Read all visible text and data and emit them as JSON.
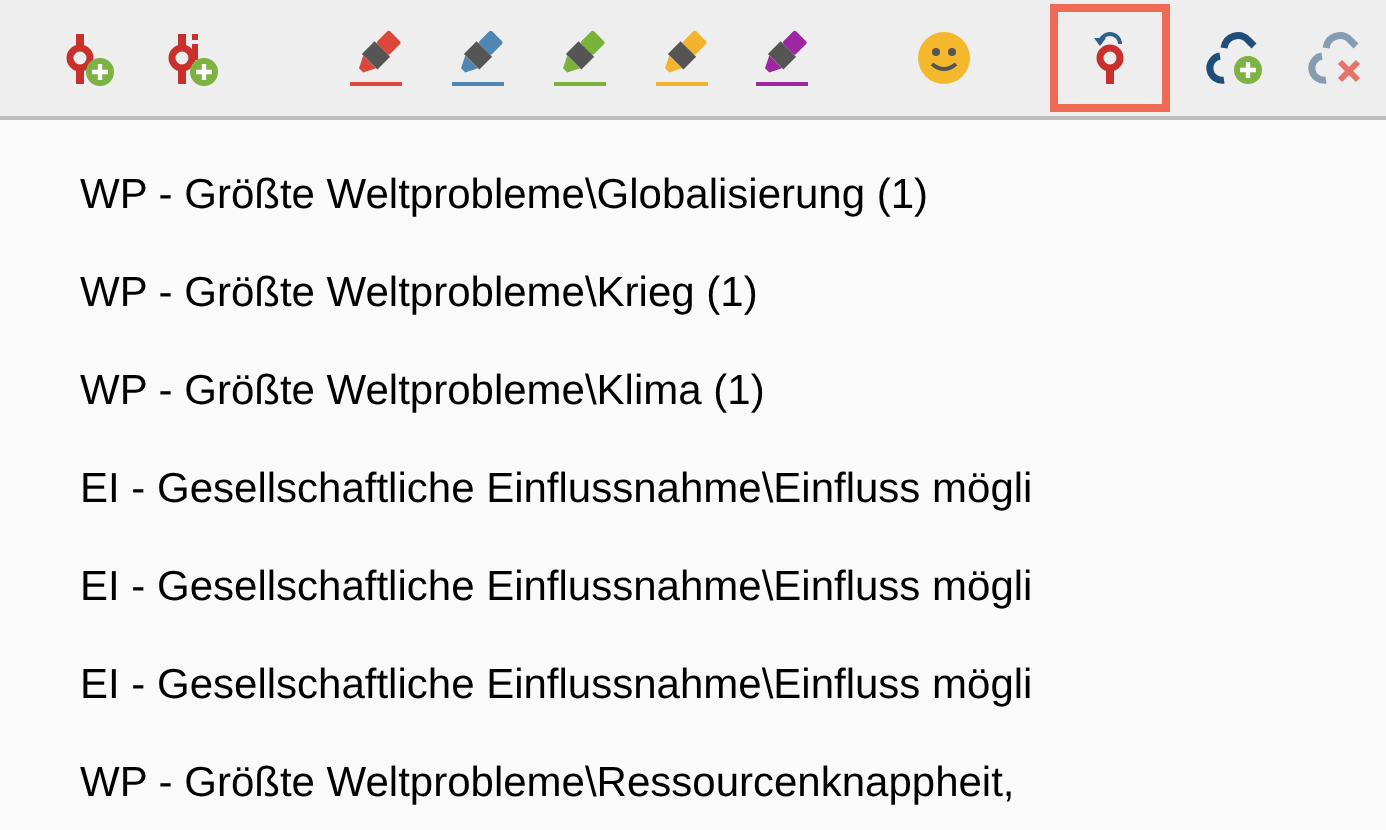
{
  "toolbar": [
    {
      "kind": "code-add",
      "selected": false
    },
    {
      "kind": "code-invivo",
      "selected": false
    },
    {
      "kind": "highlighter",
      "color": "#d9483b",
      "selected": false
    },
    {
      "kind": "highlighter",
      "color": "#4f86b4",
      "selected": false
    },
    {
      "kind": "highlighter",
      "color": "#7bb33a",
      "selected": false
    },
    {
      "kind": "highlighter",
      "color": "#f2b32f",
      "selected": false
    },
    {
      "kind": "highlighter",
      "color": "#9c27a0",
      "selected": false
    },
    {
      "kind": "emoticon",
      "selected": false
    },
    {
      "kind": "code-undo",
      "selected": true
    },
    {
      "kind": "link-add",
      "selected": false
    },
    {
      "kind": "link-remove",
      "selected": false
    }
  ],
  "menu": {
    "items": [
      "WP - Größte Weltprobleme\\Globalisierung (1)",
      "WP - Größte Weltprobleme\\Krieg (1)",
      "WP - Größte Weltprobleme\\Klima (1)",
      "EI - Gesellschaftliche Einflussnahme\\Einfluss mögli",
      "EI - Gesellschaftliche Einflussnahme\\Einfluss mögli",
      "EI - Gesellschaftliche Einflussnahme\\Einfluss mögli",
      "WP - Größte Weltprobleme\\Ressourcenknappheit,"
    ]
  }
}
